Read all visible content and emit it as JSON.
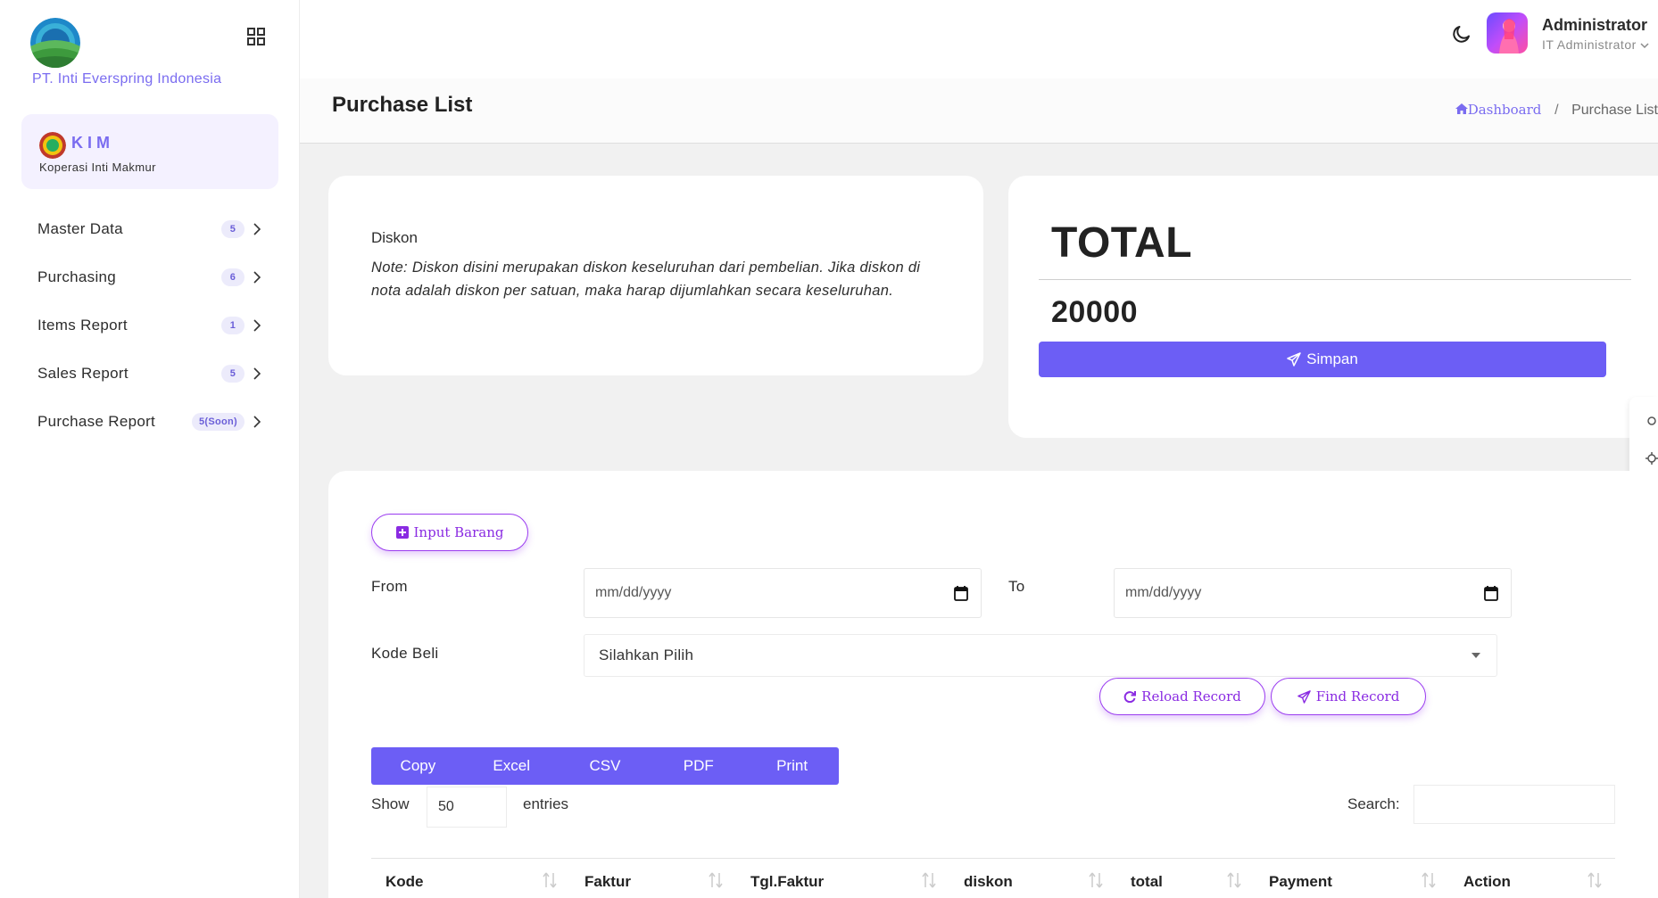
{
  "sidebar": {
    "company_name": "PT. Inti Everspring Indonesia",
    "kim": {
      "title": "KIM",
      "subtitle": "Koperasi Inti Makmur"
    },
    "items": [
      {
        "label": "Master Data",
        "badge": "5"
      },
      {
        "label": "Purchasing",
        "badge": "6"
      },
      {
        "label": "Items Report",
        "badge": "1"
      },
      {
        "label": "Sales Report",
        "badge": "5"
      },
      {
        "label": "Purchase Report",
        "badge": "5(Soon)"
      }
    ]
  },
  "topbar": {
    "user_name": "Administrator",
    "user_role": "IT Administrator",
    "icons": [
      "moon-icon",
      "avatar",
      "chevron-down-icon",
      "grid-icon"
    ]
  },
  "page": {
    "title": "Purchase List",
    "breadcrumb": {
      "home": "Dashboard",
      "separator": "/",
      "current": "Purchase List"
    }
  },
  "diskon": {
    "label": "Diskon",
    "note": "Note: Diskon disini merupakan diskon keseluruhan dari pembelian. Jika diskon di nota adalah diskon per satuan, maka harap dijumlahkan secara keseluruhan."
  },
  "total": {
    "title": "TOTAL",
    "value": "20000",
    "save_label": "Simpan"
  },
  "filters": {
    "input_barang_label": "Input Barang",
    "from_label": "From",
    "from_placeholder": "mm/dd/yyyy",
    "to_label": "To",
    "to_placeholder": "mm/dd/yyyy",
    "kode_beli_label": "Kode Beli",
    "kode_beli_value": "Silahkan Pilih",
    "reload_label": "Reload Record",
    "find_label": "Find Record"
  },
  "table": {
    "export_buttons": [
      "Copy",
      "Excel",
      "CSV",
      "PDF",
      "Print"
    ],
    "show_label": "Show",
    "entries_value": "50",
    "entries_label": "entries",
    "search_label": "Search:",
    "columns": [
      "Kode",
      "Faktur",
      "Tgl.Faktur",
      "diskon",
      "total",
      "Payment",
      "Action"
    ]
  },
  "colors": {
    "accent": "#6c5ef5",
    "pill_border": "#9b3df0",
    "brand_text": "#7a6cf0"
  }
}
